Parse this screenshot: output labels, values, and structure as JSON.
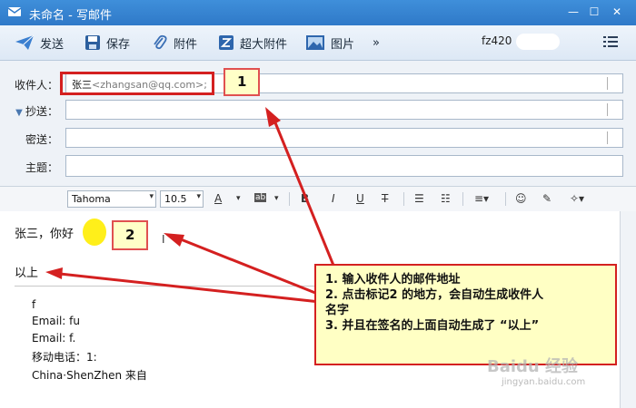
{
  "window": {
    "title": "未命名 - 写邮件"
  },
  "toolbar": {
    "send": "发送",
    "save": "保存",
    "attach": "附件",
    "big_attach": "超大附件",
    "image": "图片",
    "more": "»",
    "account": "fz420"
  },
  "fields": {
    "to_label": "收件人：",
    "to_name": "张三",
    "to_addr": "<zhangsan@qq.com>;",
    "cc_label": "抄送：",
    "bcc_label": "密送：",
    "subject_label": "主题："
  },
  "format": {
    "font": "Tahoma",
    "size": "10.5"
  },
  "body": {
    "greeting": "张三，你好",
    "closing": "以上",
    "sig": {
      "line1": "f",
      "line2": "Email:  fu",
      "line3": "Email:  f.",
      "line4": "移动电话：1:",
      "line5": "China·ShenZhen   来自"
    }
  },
  "annotations": {
    "label1": "1",
    "label2": "2",
    "note1": "1.  输入收件人的邮件地址",
    "note2a": "2.  点击标记2 的地方，会自动生成收件人",
    "note2b": "名字",
    "note3": "3.  并且在签名的上面自动生成了 “以上”"
  },
  "watermark": {
    "brand": "Baidu 经验",
    "url": "jingyan.baidu.com"
  },
  "colors": {
    "titlebar": "#2f79c8",
    "highlight": "#d42020",
    "callout_fill": "#ffffc4",
    "marker": "#ffef1a"
  }
}
